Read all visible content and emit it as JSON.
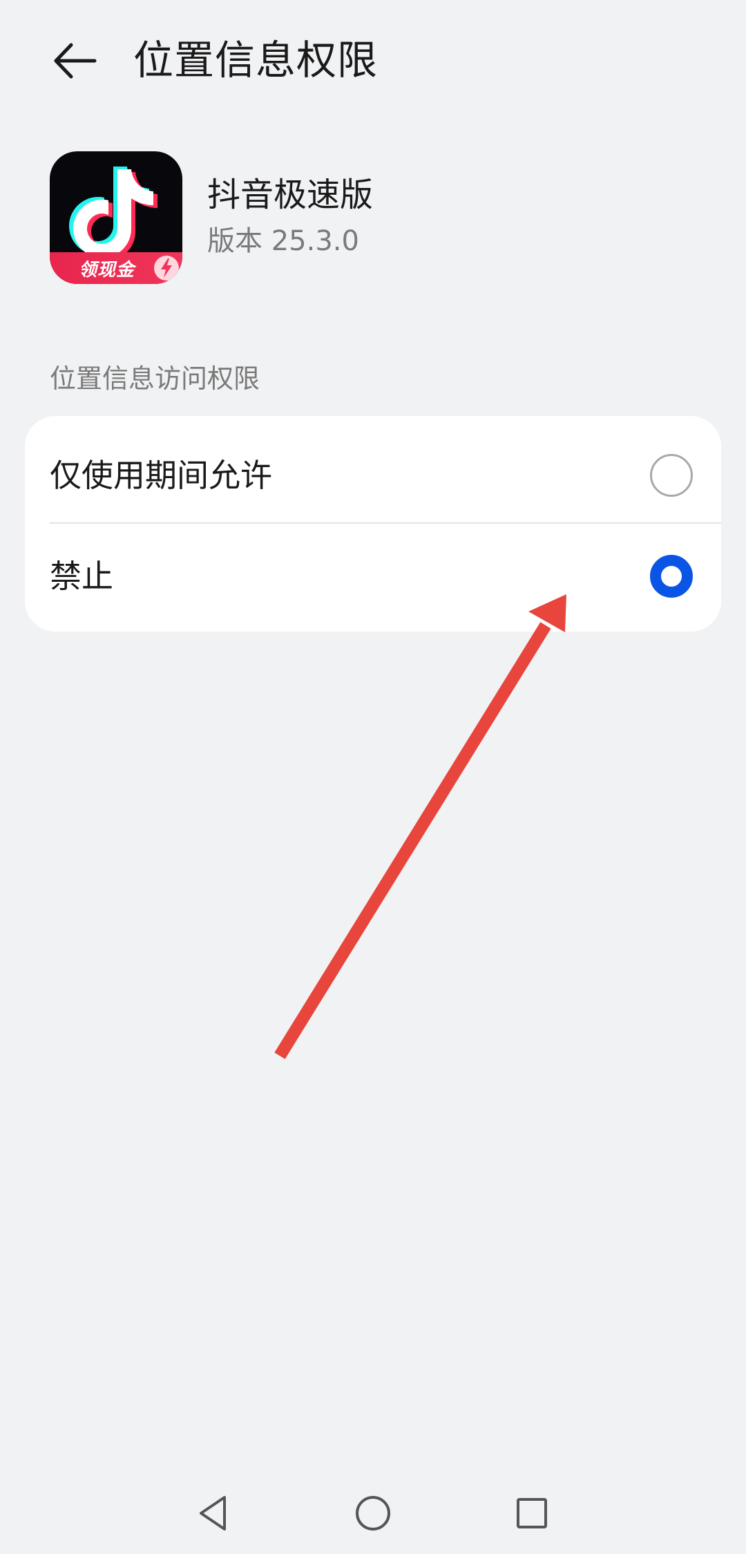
{
  "header": {
    "title": "位置信息权限"
  },
  "app": {
    "name": "抖音极速版",
    "version": "版本 25.3.0",
    "icon_badge": "领现金"
  },
  "section": {
    "label": "位置信息访问权限"
  },
  "options": [
    {
      "label": "仅使用期间允许",
      "selected": false
    },
    {
      "label": "禁止",
      "selected": true
    }
  ],
  "colors": {
    "background": "#f1f2f4",
    "card": "#ffffff",
    "accent": "#0b55e6",
    "annotation_arrow": "#e8453c",
    "icon_ribbon": "#e8254d"
  },
  "icons": {
    "back": "arrow-left-icon",
    "app_icon": "douyin-note-icon",
    "bolt": "lightning-bolt-icon",
    "nav_back": "triangle-back-icon",
    "nav_home": "circle-home-icon",
    "nav_recent": "square-recent-icon"
  }
}
